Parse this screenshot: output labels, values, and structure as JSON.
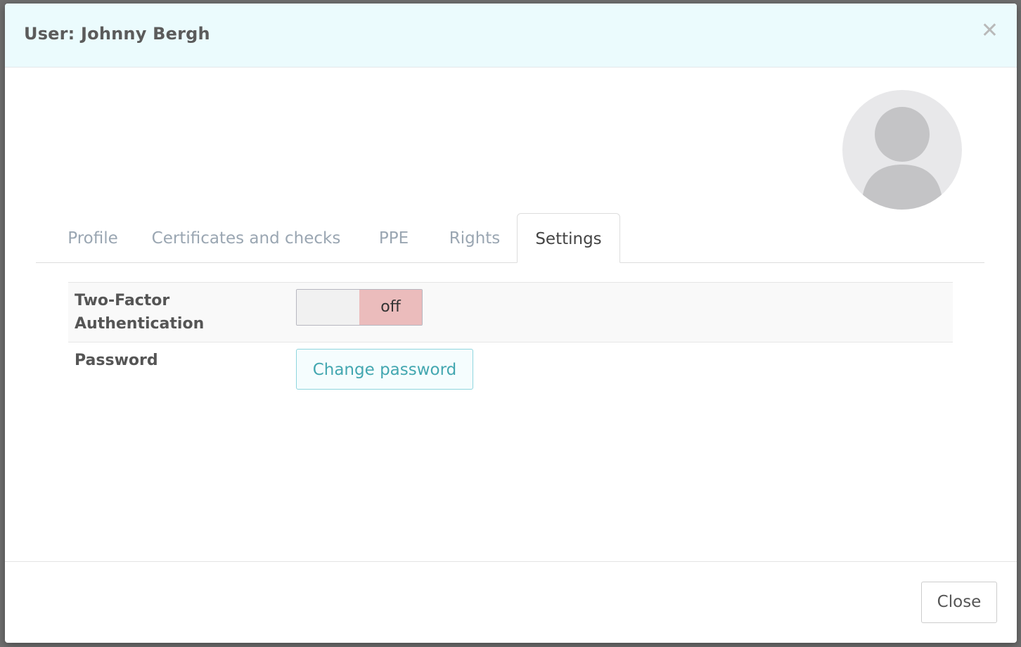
{
  "modal": {
    "title": "User: Johnny Bergh",
    "close_icon": "close-icon"
  },
  "avatar": {
    "icon": "user-avatar-icon"
  },
  "tabs": [
    {
      "label": "Profile",
      "active": false
    },
    {
      "label": "Certificates and checks",
      "active": false
    },
    {
      "label": "PPE",
      "active": false
    },
    {
      "label": "Rights",
      "active": false
    },
    {
      "label": "Settings",
      "active": true
    }
  ],
  "settings": {
    "two_factor": {
      "label": "Two-Factor Authentication",
      "state_label": "off",
      "enabled": false
    },
    "password": {
      "label": "Password",
      "button_label": "Change password"
    }
  },
  "footer": {
    "close_label": "Close"
  },
  "colors": {
    "header_bg": "#ebfbfd",
    "toggle_off_bg": "#ebbcbc",
    "accent": "#43a7b0"
  }
}
